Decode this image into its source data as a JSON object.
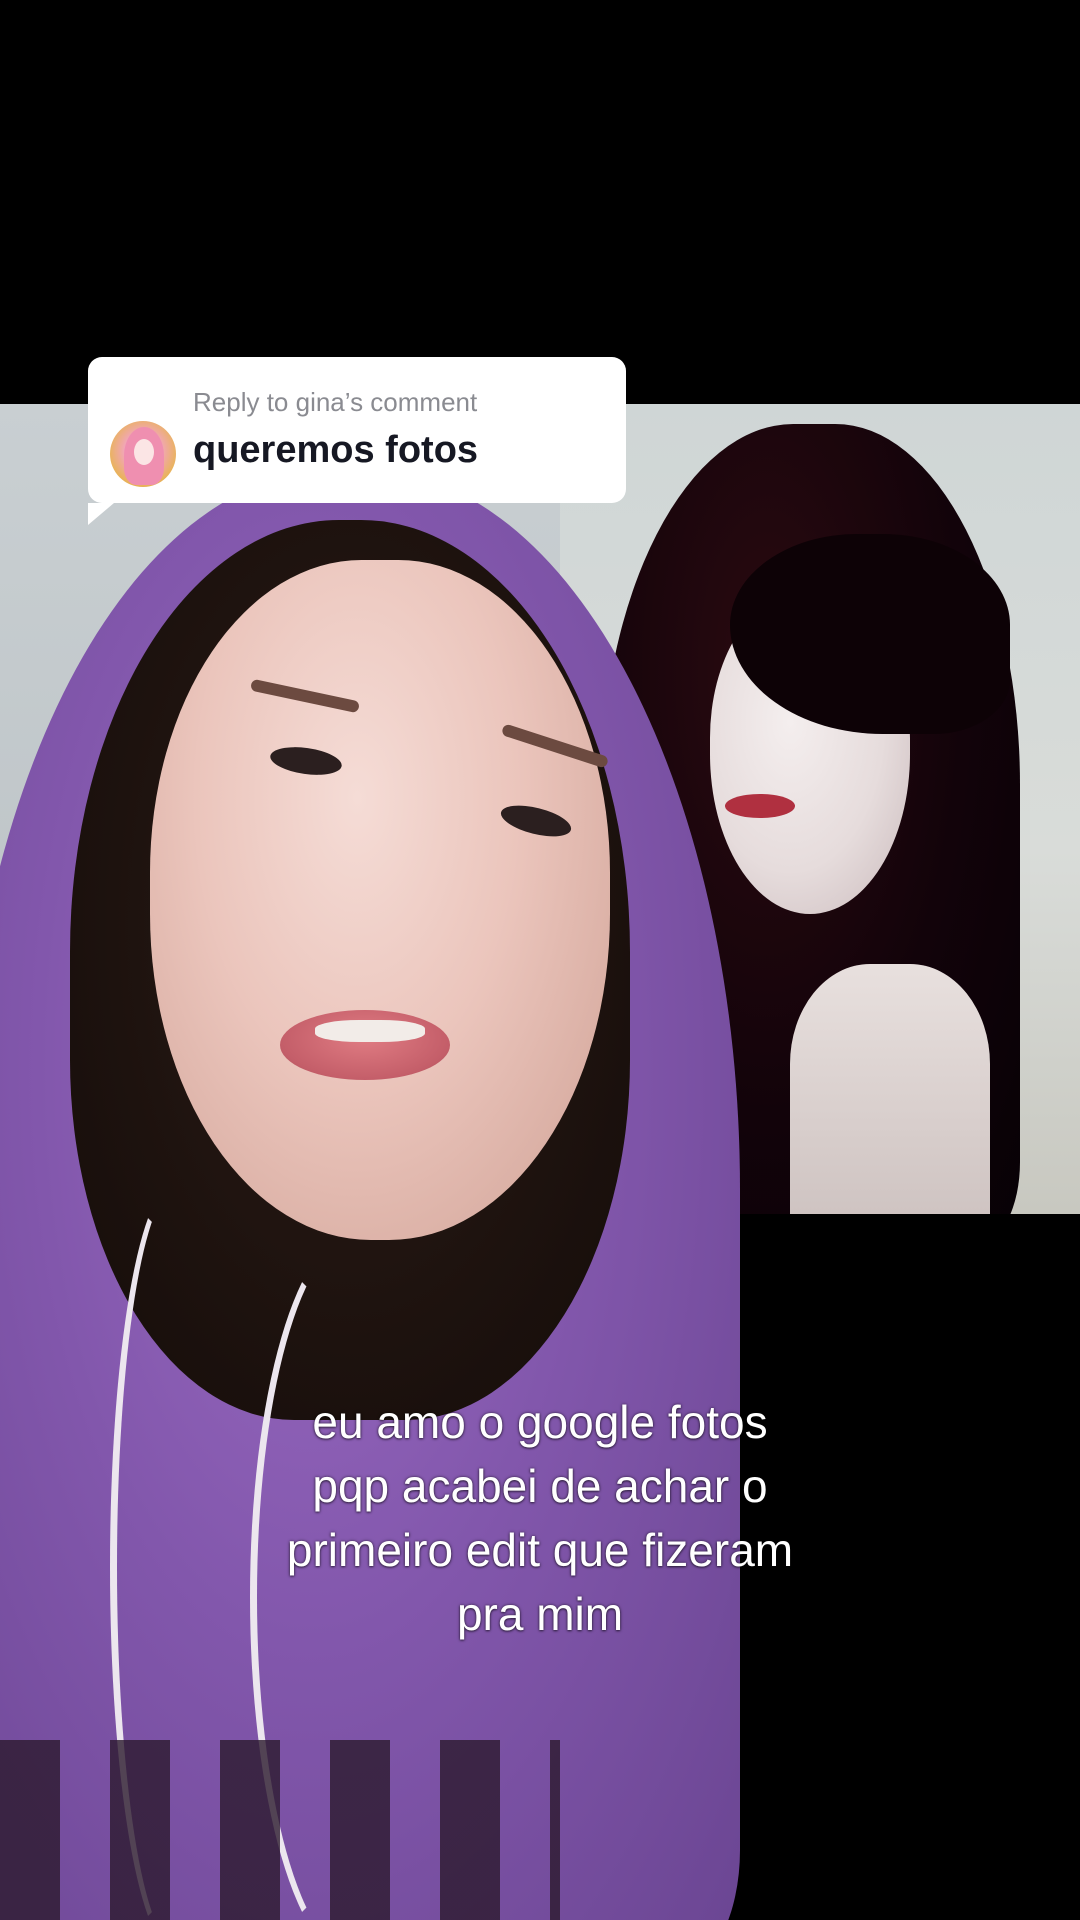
{
  "reply": {
    "label": "Reply to gina’s comment",
    "comment": "queremos fotos"
  },
  "caption": {
    "lines": [
      "eu amo o google fotos",
      "pqp acabei de achar o",
      "primeiro edit que fizeram",
      "pra mim"
    ]
  },
  "colors": {
    "bubble_bg": "#ffffff",
    "label_gray": "#8a8b91",
    "comment_text": "#161823",
    "hoodie_purple": "#8257ac"
  }
}
